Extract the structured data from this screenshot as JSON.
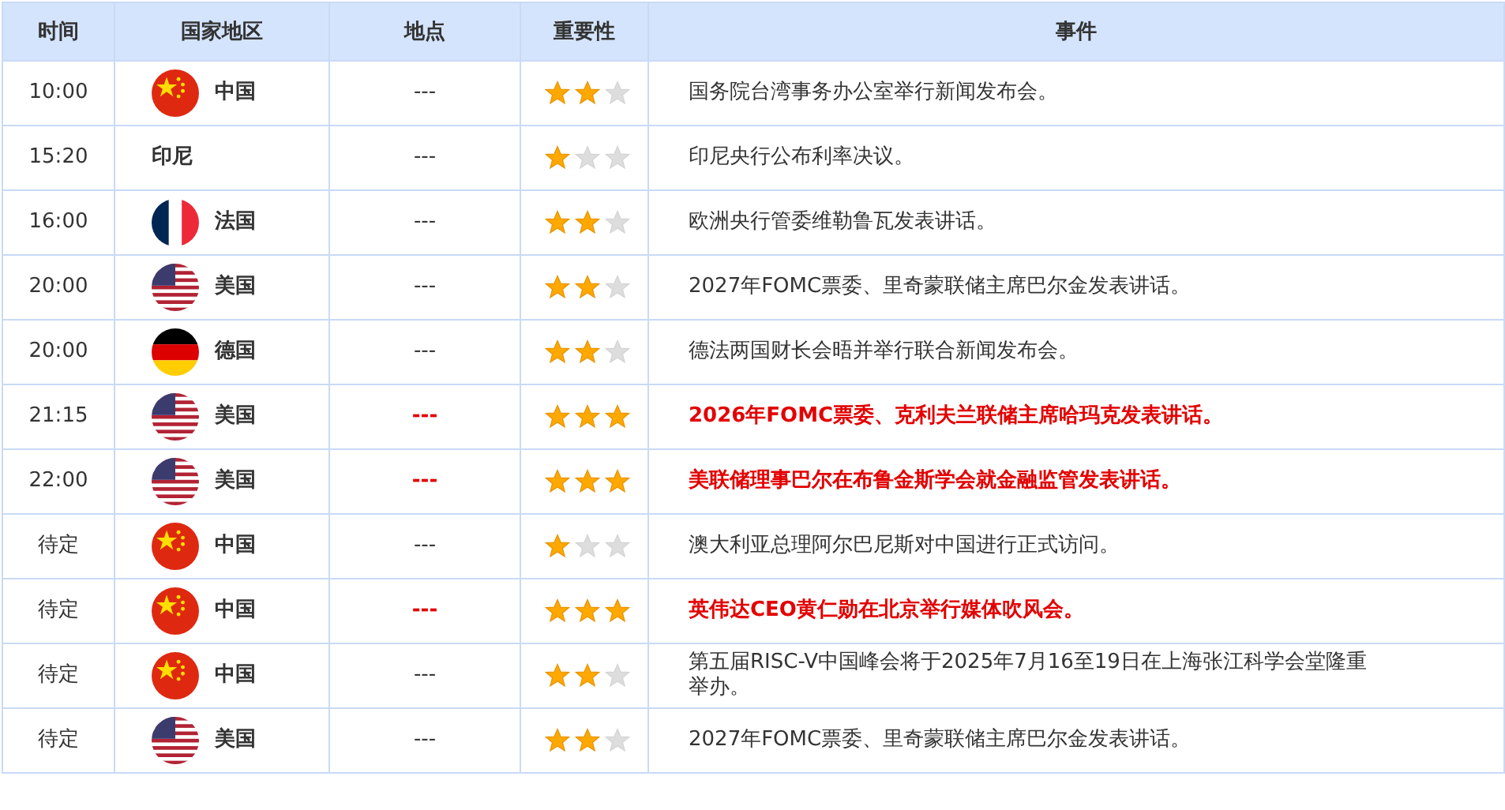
{
  "table": {
    "columns": [
      "时间",
      "国家地区",
      "地点",
      "重要性",
      "事件"
    ],
    "rows": [
      {
        "time": "10:00",
        "flag": {
          "kind": "cn"
        },
        "country": "中国",
        "location": "---",
        "stars": 2,
        "important": false,
        "event": "国务院台湾事务办公室举行新闻发布会。"
      },
      {
        "time": "15:20",
        "country": "印尼",
        "location": "---",
        "stars": 1,
        "important": false,
        "event": "印尼央行公布利率决议。"
      },
      {
        "time": "16:00",
        "flag": {
          "kind": "fr"
        },
        "country": "法国",
        "location": "---",
        "stars": 2,
        "important": false,
        "event": "欧洲央行管委维勒鲁瓦发表讲话。"
      },
      {
        "time": "20:00",
        "flag": {
          "kind": "us"
        },
        "country": "美国",
        "location": "---",
        "stars": 2,
        "important": false,
        "event": "2027年FOMC票委、里奇蒙联储主席巴尔金发表讲话。"
      },
      {
        "time": "20:00",
        "flag": {
          "kind": "de"
        },
        "country": "德国",
        "location": "---",
        "stars": 2,
        "important": false,
        "event": "德法两国财长会晤并举行联合新闻发布会。"
      },
      {
        "time": "21:15",
        "flag": {
          "kind": "us"
        },
        "country": "美国",
        "location": "---",
        "stars": 3,
        "important": true,
        "event": "2026年FOMC票委、克利夫兰联储主席哈玛克发表讲话。"
      },
      {
        "time": "22:00",
        "flag": {
          "kind": "us"
        },
        "country": "美国",
        "location": "---",
        "stars": 3,
        "important": true,
        "event": "美联储理事巴尔在布鲁金斯学会就金融监管发表讲话。"
      },
      {
        "time": "待定",
        "flag": {
          "kind": "cn"
        },
        "country": "中国",
        "location": "---",
        "stars": 1,
        "important": false,
        "event": "澳大利亚总理阿尔巴尼斯对中国进行正式访问。"
      },
      {
        "time": "待定",
        "flag": {
          "kind": "cn"
        },
        "country": "中国",
        "location": "---",
        "stars": 3,
        "important": true,
        "event": "英伟达CEO黄仁勋在北京举行媒体吹风会。"
      },
      {
        "time": "待定",
        "flag": {
          "kind": "cn"
        },
        "country": "中国",
        "location": "---",
        "stars": 2,
        "important": false,
        "event": "第五届RISC-V中国峰会将于2025年7月16至19日在上海张江科学会堂隆重举办。"
      },
      {
        "time": "待定",
        "flag": {
          "kind": "us"
        },
        "country": "美国",
        "location": "---",
        "stars": 2,
        "important": false,
        "event": "2027年FOMC票委、里奇蒙联储主席巴尔金发表讲话。"
      }
    ]
  }
}
